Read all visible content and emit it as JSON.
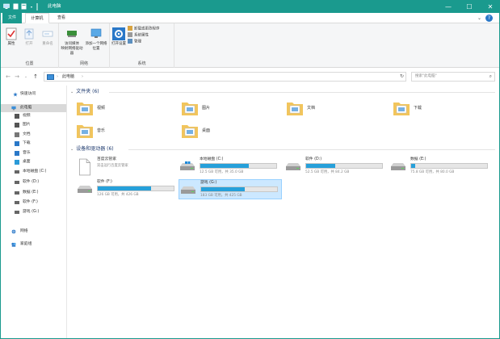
{
  "title_bar": {
    "title": "此电脑",
    "quick_access_icons": [
      "computer-icon",
      "save-icon",
      "new-folder-icon",
      "dropdown-icon"
    ],
    "window_buttons": {
      "minimize": "—",
      "maximize": "☐",
      "close": "✕"
    }
  },
  "ribbon_tabs": {
    "file": "文件",
    "computer": "计算机",
    "view": "查看",
    "collapse_chevron": "⌄",
    "help": "?"
  },
  "ribbon": {
    "location": {
      "label": "位置",
      "properties": "属性",
      "open": "打开",
      "rename": "重命名"
    },
    "network": {
      "label": "网络",
      "access_media": "访问媒体",
      "map_drive": "映射网络驱动器",
      "add_location": "添加一个网络位置"
    },
    "system": {
      "label": "系统",
      "open_settings": "打开设置",
      "uninstall": "卸载或更改程序",
      "system_properties": "系统属性",
      "manage": "管理"
    }
  },
  "address_bar": {
    "back": "←",
    "forward": "→",
    "recent": "⌄",
    "up": "↑",
    "breadcrumb": [
      "此电脑"
    ],
    "separator": "›",
    "refresh": "↻",
    "search_placeholder": "搜索\"此电脑\"",
    "search_icon": "⌕"
  },
  "sidebar": {
    "quick_access": "快速访问",
    "this_pc": "此电脑",
    "items": [
      {
        "label": "视频",
        "icon": "video-icon",
        "color": "#555555"
      },
      {
        "label": "图片",
        "icon": "picture-icon",
        "color": "#555555"
      },
      {
        "label": "文档",
        "icon": "document-icon",
        "color": "#777777"
      },
      {
        "label": "下载",
        "icon": "download-icon",
        "color": "#2a78c8"
      },
      {
        "label": "音乐",
        "icon": "music-icon",
        "color": "#2a78c8"
      },
      {
        "label": "桌面",
        "icon": "desktop-icon",
        "color": "#2a9ad8"
      },
      {
        "label": "本地磁盘 (C:)",
        "icon": "drive-icon",
        "color": "#666666"
      },
      {
        "label": "软件 (D:)",
        "icon": "drive-icon",
        "color": "#666666"
      },
      {
        "label": "数据 (E:)",
        "icon": "drive-icon",
        "color": "#666666"
      },
      {
        "label": "软件 (F:)",
        "icon": "drive-icon",
        "color": "#666666"
      },
      {
        "label": "游戏 (G:)",
        "icon": "drive-icon",
        "color": "#666666"
      }
    ],
    "network": "网络",
    "homegroup": "家庭组"
  },
  "folders_section": {
    "title": "文件夹 (6)",
    "chevron": "⌄",
    "items": [
      {
        "label": "视频",
        "icon": "video-folder-icon"
      },
      {
        "label": "图片",
        "icon": "picture-folder-icon"
      },
      {
        "label": "文档",
        "icon": "document-folder-icon"
      },
      {
        "label": "下载",
        "icon": "download-folder-icon"
      },
      {
        "label": "音乐",
        "icon": "music-folder-icon"
      },
      {
        "label": "桌面",
        "icon": "desktop-folder-icon"
      }
    ]
  },
  "devices_section": {
    "title": "设备和驱动器 (6)",
    "chevron": "⌄",
    "baidu": {
      "name": "百度云管家",
      "subtitle": "双击运行百度云管家"
    },
    "drives": [
      {
        "name": "本地磁盘 (C:)",
        "stats": "12.5 GB 可用，共 35.0 GB",
        "used": 0.64,
        "icon": "windows-drive-icon"
      },
      {
        "name": "软件 (D:)",
        "stats": "52.5 GB 可用，共 84.2 GB",
        "used": 0.38,
        "icon": "drive-icon"
      },
      {
        "name": "数据 (E:)",
        "stats": "75.8 GB 可用，共 80.0 GB",
        "used": 0.05,
        "icon": "drive-icon"
      },
      {
        "name": "软件 (F:)",
        "stats": "126 GB 可用，共 426 GB",
        "used": 0.7,
        "icon": "drive-icon"
      },
      {
        "name": "游戏 (G:)",
        "stats": "183 GB 可用，共 425 GB",
        "used": 0.57,
        "icon": "drive-icon"
      }
    ]
  },
  "colors": {
    "accent": "#1a9a8e",
    "selection": "#cce8ff",
    "bar_fill": "#26a0da",
    "folder": "#f2c55c"
  }
}
